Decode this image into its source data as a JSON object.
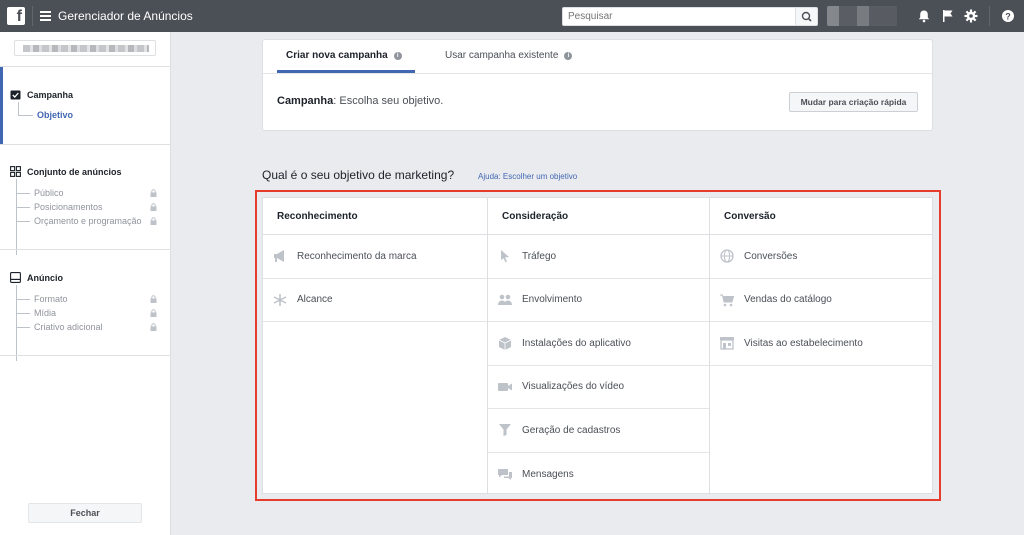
{
  "topbar": {
    "logo": "f",
    "app_title": "Gerenciador de Anúncios",
    "search_placeholder": "Pesquisar",
    "icons": [
      "menu-icon",
      "search-icon",
      "bell-icon",
      "flag-icon",
      "gear-icon",
      "help-icon"
    ]
  },
  "sidebar": {
    "sections": [
      {
        "title": "Campanha",
        "icon": "campaign-icon",
        "items": [
          {
            "label": "Objetivo",
            "active": true,
            "locked": false
          }
        ]
      },
      {
        "title": "Conjunto de anúncios",
        "icon": "adset-icon",
        "items": [
          {
            "label": "Público",
            "locked": true
          },
          {
            "label": "Posicionamentos",
            "locked": true
          },
          {
            "label": "Orçamento e programação",
            "locked": true
          }
        ]
      },
      {
        "title": "Anúncio",
        "icon": "ad-icon",
        "items": [
          {
            "label": "Formato",
            "locked": true
          },
          {
            "label": "Mídia",
            "locked": true
          },
          {
            "label": "Criativo adicional",
            "locked": true
          }
        ]
      }
    ],
    "close_label": "Fechar"
  },
  "campaign_card": {
    "tabs": [
      {
        "label": "Criar nova campanha",
        "active": true
      },
      {
        "label": "Usar campanha existente",
        "active": false
      }
    ],
    "campaign_label": "Campanha",
    "campaign_text": ": Escolha seu objetivo.",
    "quick_create_label": "Mudar para criação rápida"
  },
  "objective": {
    "question": "Qual é o seu objetivo de marketing?",
    "help_link": "Ajuda: Escolher um objetivo",
    "columns": [
      {
        "title": "Reconhecimento",
        "items": [
          {
            "label": "Reconhecimento da marca",
            "icon": "megaphone-icon"
          },
          {
            "label": "Alcance",
            "icon": "asterisk-icon"
          }
        ]
      },
      {
        "title": "Consideração",
        "items": [
          {
            "label": "Tráfego",
            "icon": "cursor-icon"
          },
          {
            "label": "Envolvimento",
            "icon": "people-icon"
          },
          {
            "label": "Instalações do aplicativo",
            "icon": "box-icon"
          },
          {
            "label": "Visualizações do vídeo",
            "icon": "video-icon"
          },
          {
            "label": "Geração de cadastros",
            "icon": "funnel-icon"
          },
          {
            "label": "Mensagens",
            "icon": "chat-icon"
          }
        ]
      },
      {
        "title": "Conversão",
        "items": [
          {
            "label": "Conversões",
            "icon": "globe-icon"
          },
          {
            "label": "Vendas do catálogo",
            "icon": "cart-icon"
          },
          {
            "label": "Visitas ao estabelecimento",
            "icon": "store-icon"
          }
        ]
      }
    ]
  },
  "colors": {
    "topbar": "#4b4f56",
    "accent": "#4267b2",
    "highlight": "#e53c2c",
    "background": "#e9ebee"
  }
}
